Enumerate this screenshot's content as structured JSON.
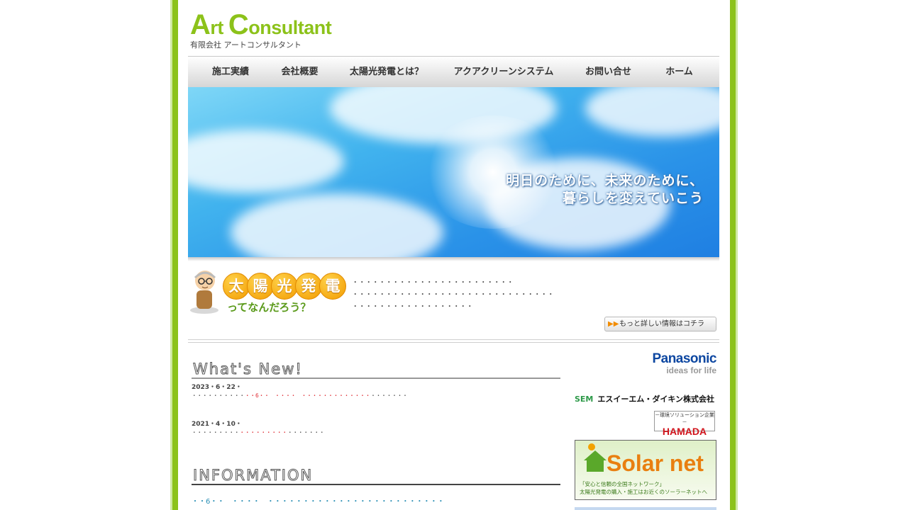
{
  "logo": {
    "main_a": "A",
    "main_rt": "rt ",
    "main_c": "C",
    "main_rest": "onsultant",
    "sub": "有限会社 アートコンサルタント"
  },
  "nav": {
    "items": [
      {
        "label": "施工実績"
      },
      {
        "label": "会社概要"
      },
      {
        "label": "太陽光発電とは？"
      },
      {
        "label": "アクアクリーンシステム"
      },
      {
        "label": "お問い合せ"
      },
      {
        "label": "ホーム"
      }
    ]
  },
  "hero": {
    "line1": "明日のために、未来のために、",
    "line2": "暮らしを変えていこう"
  },
  "solar": {
    "chars": [
      "太",
      "陽",
      "光",
      "発",
      "電"
    ],
    "subtitle": "ってなんだろう？",
    "text_lines": [
      "・・・・・・・・・・・・・・・・・・・・・・・・",
      "・・・・・・・・・・・・・・・・・・・・・・・・・・・・・・",
      "・・・・・・・・・・・・・・・・・・"
    ],
    "more_label": "もっと詳しい情報はコチラ"
  },
  "whats_new": {
    "heading": "What's New!",
    "items": [
      {
        "date": "2023・6・22・",
        "pre": "・・・・・・・・・・",
        "link": "・・6・・　・・・・　・・・・・・・・・・・・・",
        "post": "・・・・・・・"
      },
      {
        "date": "2021・4・10・",
        "pre": "・・・・・・・・・",
        "link": "・・・・・・・・・",
        "post": "・・・・・・・"
      }
    ]
  },
  "information": {
    "heading": "INFORMATION",
    "link": "・・6・・　・・・・　・・・・・・・・・・・・・・・・・・・・・・・・・"
  },
  "sponsors": {
    "panasonic": "Panasonic",
    "panasonic_tag": "ideas for life",
    "sem_mark": "SEM",
    "sem": "エスイーエム・ダイキン株式会社",
    "hamada_tag": "－環境ソリューション企業－",
    "hamada": "HAMADA",
    "solarnet": "Solar net",
    "solarnet_tag1": "「安心と信頼の全国ネットワーク」",
    "solarnet_tag2": "太陽光発電の購入・施工はお近くのソーラーネットへ"
  }
}
